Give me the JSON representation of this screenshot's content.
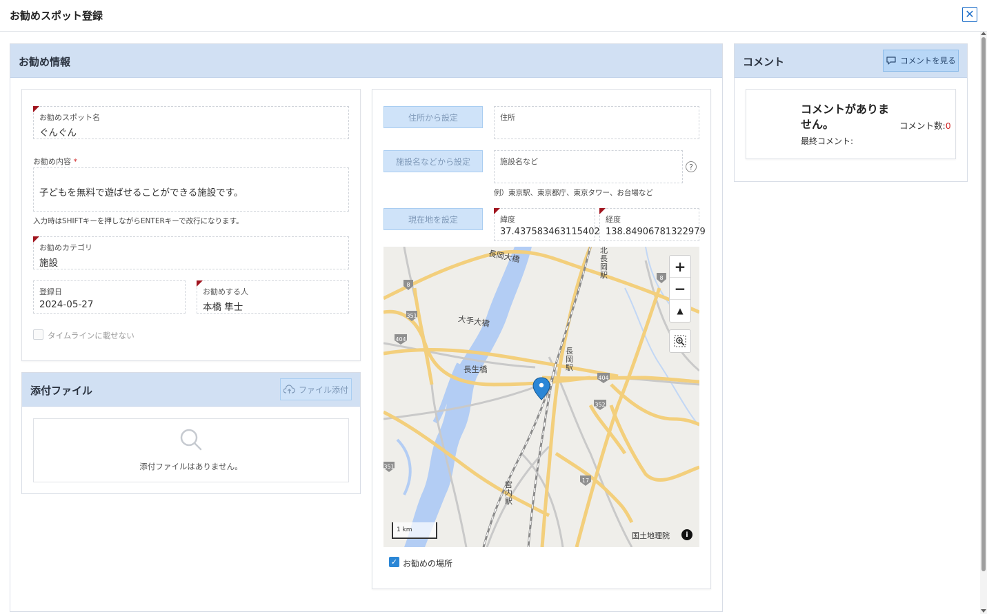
{
  "dialog": {
    "title": "お勧めスポット登録",
    "close_label": "✕"
  },
  "main": {
    "header": "お勧め情報",
    "spot_name": {
      "label": "お勧めスポット名",
      "value": "ぐんぐん"
    },
    "content": {
      "label": "お勧め内容",
      "required_mark": "*",
      "value": "子どもを無料で遊ばせることができる施設です。",
      "hint": "入力時はSHIFTキーを押しながらENTERキーで改行になります。"
    },
    "category": {
      "label": "お勧めカテゴリ",
      "value": "施設"
    },
    "date": {
      "label": "登録日",
      "value": "2024-05-27"
    },
    "person": {
      "label": "お勧めする人",
      "value": "本橋 隼士"
    },
    "timeline": {
      "label": "タイムラインに載せない"
    }
  },
  "attachments": {
    "header": "添付ファイル",
    "add_button": "ファイル添付",
    "empty_text": "添付ファイルはありません。"
  },
  "location": {
    "address_button": "住所から設定",
    "address_label": "住所",
    "facility_button": "施設名などから設定",
    "facility_label": "施設名など",
    "facility_hint": "例）東京駅、東京都庁、東京タワー、お台場など",
    "current_button": "現在地を設定",
    "latitude": {
      "label": "緯度",
      "value": "37.437583463115402"
    },
    "longitude": {
      "label": "経度",
      "value": "138.84906781322979"
    },
    "map": {
      "labels": {
        "bridge1": "長岡大橋",
        "bridge2": "大手大橋",
        "bridge3": "長生橋",
        "station1": "北長岡駅",
        "station2": "長岡駅",
        "station3": "宮内駅"
      },
      "route_numbers": [
        "8",
        "8",
        "351",
        "404",
        "404",
        "352",
        "351",
        "17"
      ],
      "scale": "1 km",
      "attribution": "国土地理院",
      "zoom_in": "+",
      "zoom_out": "−",
      "compass": "▲"
    },
    "show_place": {
      "label": "お勧めの場所",
      "checked": true
    }
  },
  "comments": {
    "header": "コメント",
    "view_button": "コメントを見る",
    "empty_text": "コメントがありません。",
    "last_comment_label": "最終コメント:",
    "count_label": "コメント数:",
    "count_value": "0"
  },
  "colors": {
    "header_bg": "#d1e0f3",
    "accent": "#1e6fc9",
    "required": "#a0141e",
    "marker": "#2a86d6"
  }
}
